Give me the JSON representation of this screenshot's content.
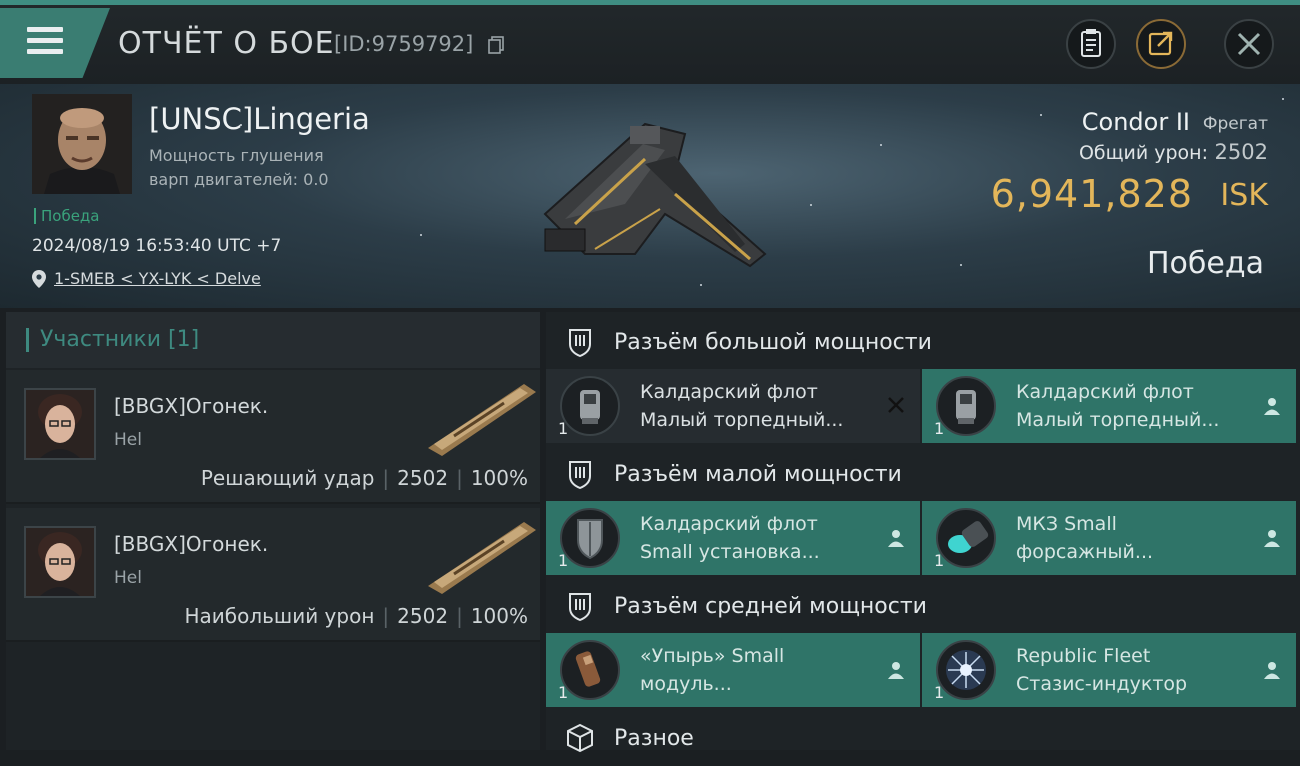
{
  "header": {
    "title": "ОТЧЁТ О БОЕ",
    "report_id": "[ID:9759792]",
    "icons": [
      "menu-icon",
      "copy-icon",
      "clipboard-icon",
      "share-icon",
      "close-icon"
    ]
  },
  "victim": {
    "pilot_name": "[UNSC]Lingeria",
    "warp_line1": "Мощность глушения",
    "warp_line2": "варп двигателей: 0.0",
    "result_tag": "Победа",
    "datetime": "2024/08/19 16:53:40 UTC +7",
    "location": "1-SMEB < YX-LYK < Delve",
    "ship_name": "Condor II",
    "ship_class": "Фрегат",
    "total_damage_label": "Общий урон:",
    "total_damage": "2502",
    "isk_value": "6,941,828",
    "isk_unit": "ISK",
    "result": "Победа"
  },
  "participants": {
    "title": "Участники [1]",
    "items": [
      {
        "name": "[BBGX]Огонек.",
        "ship": "Hel",
        "role": "Решающий удар",
        "damage": "2502",
        "percent": "100%"
      },
      {
        "name": "[BBGX]Огонек.",
        "ship": "Hel",
        "role": "Наибольший урон",
        "damage": "2502",
        "percent": "100%"
      }
    ]
  },
  "fitting": {
    "high": {
      "title": "Разъём большой мощности",
      "modules": [
        {
          "line1": "Калдарский флот",
          "line2": "Малый торпедный...",
          "qty": "1",
          "state": "destroyed"
        },
        {
          "line1": "Калдарский флот",
          "line2": "Малый торпедный...",
          "qty": "1",
          "state": "dropped"
        }
      ]
    },
    "low": {
      "title": "Разъём малой мощности",
      "modules": [
        {
          "line1": "Калдарский флот",
          "line2": "Small установка...",
          "qty": "1",
          "state": "dropped"
        },
        {
          "line1": "МКЗ Small",
          "line2": "форсажный...",
          "qty": "1",
          "state": "dropped"
        }
      ]
    },
    "mid": {
      "title": "Разъём средней мощности",
      "modules": [
        {
          "line1": "«Упырь» Small",
          "line2": "модуль...",
          "qty": "1",
          "state": "dropped"
        },
        {
          "line1": "Republic Fleet",
          "line2": "Стазис-индуктор",
          "qty": "1",
          "state": "dropped"
        }
      ]
    },
    "misc": {
      "title": "Разное"
    }
  },
  "colors": {
    "accent_teal": "#3f8e82",
    "isk_gold": "#e3b65a",
    "victory_green": "#3aa37c"
  }
}
